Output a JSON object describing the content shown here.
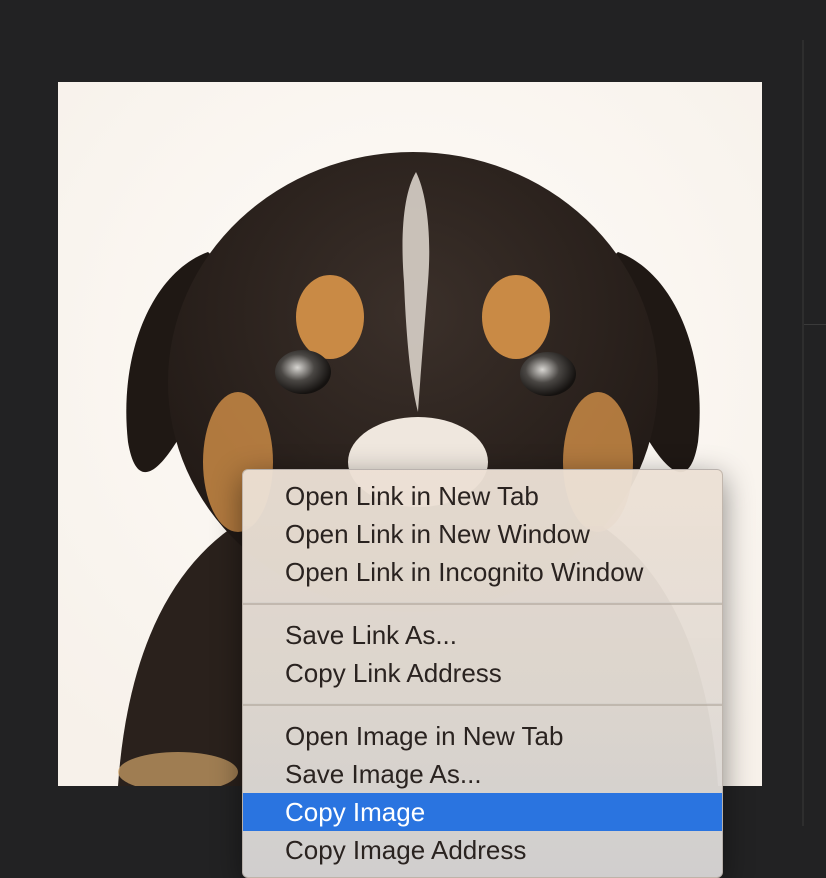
{
  "image": {
    "subject": "puppy-photo",
    "background_color": "#fdfaf6"
  },
  "context_menu": {
    "highlight_color": "#2a74e0",
    "groups": [
      {
        "items": [
          "Open Link in New Tab",
          "Open Link in New Window",
          "Open Link in Incognito Window"
        ]
      },
      {
        "items": [
          "Save Link As...",
          "Copy Link Address"
        ]
      },
      {
        "items": [
          "Open Image in New Tab",
          "Save Image As...",
          "Copy Image",
          "Copy Image Address"
        ]
      }
    ],
    "highlighted_item": "Copy Image"
  }
}
